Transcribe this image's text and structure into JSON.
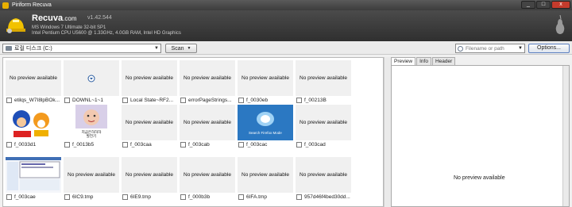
{
  "window": {
    "title": "Piriform Recuva",
    "btn_min": "_",
    "btn_max": "□",
    "btn_close": "x"
  },
  "header": {
    "brand": "Recuva",
    "brand_suffix": ".com",
    "version": "v1.42.544",
    "os": "MS Windows 7 Ultimate 32-bit SP1",
    "cpu": "Intel Pentium CPU U5600 @ 1.33GHz, 4.0GB RAM, Intel HD Graphics"
  },
  "toolbar": {
    "drive": "로컬 디스크 (C:)",
    "scan_label": "Scan",
    "search_placeholder": "Filename or path",
    "options_label": "Options..."
  },
  "files": [
    {
      "name": "etilqs_W7I8lpBOk...",
      "preview": "No preview available",
      "kind": "none"
    },
    {
      "name": "DOWNL~1~1",
      "preview": "",
      "kind": "icon"
    },
    {
      "name": "Local State~RF2...",
      "preview": "No preview available",
      "kind": "none"
    },
    {
      "name": "errorPageStrings...",
      "preview": "No preview available",
      "kind": "none"
    },
    {
      "name": "f_0030eb",
      "preview": "No preview available",
      "kind": "none"
    },
    {
      "name": "f_00213B",
      "preview": "No preview available",
      "kind": "none"
    },
    {
      "name": "f_0033d1",
      "preview": "",
      "kind": "sonic"
    },
    {
      "name": "f_0013b5",
      "preview": "",
      "kind": "baby",
      "overlay": "지금은하하하\n발전기"
    },
    {
      "name": "f_003caa",
      "preview": "No preview available",
      "kind": "none"
    },
    {
      "name": "f_003cab",
      "preview": "No preview available",
      "kind": "none"
    },
    {
      "name": "f_003cac",
      "preview": "",
      "kind": "firefox",
      "overlay": "Search Firefox Mode"
    },
    {
      "name": "f_003cad",
      "preview": "No preview available",
      "kind": "none"
    },
    {
      "name": "f_003cae",
      "preview": "",
      "kind": "screenshot"
    },
    {
      "name": "6IC9.tmp",
      "preview": "No preview available",
      "kind": "none"
    },
    {
      "name": "6IE9.tmp",
      "preview": "No preview available",
      "kind": "none"
    },
    {
      "name": "f_000b3b",
      "preview": "No preview available",
      "kind": "none"
    },
    {
      "name": "6IFA.tmp",
      "preview": "No preview available",
      "kind": "none"
    },
    {
      "name": "957d46f4bed30dd...",
      "preview": "No preview available",
      "kind": "none"
    }
  ],
  "preview": {
    "tabs": [
      "Preview",
      "Info",
      "Header"
    ],
    "active_tab": "Preview",
    "message": "No preview available"
  }
}
